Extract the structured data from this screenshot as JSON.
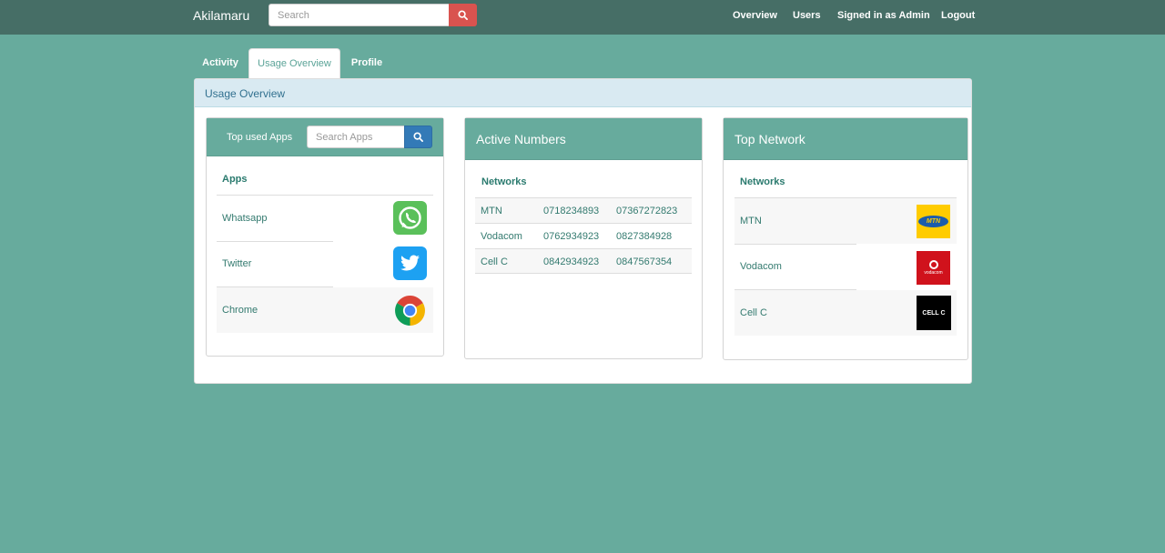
{
  "navbar": {
    "brand": "Akilamaru",
    "search_placeholder": "Search",
    "links": [
      "Overview",
      "Users",
      "Signed in as Admin",
      "Logout"
    ]
  },
  "tabs": [
    "Activity",
    "Usage Overview",
    "Profile"
  ],
  "active_tab": "Usage Overview",
  "panel": {
    "title": "Usage Overview"
  },
  "top_apps": {
    "title": "Top used Apps",
    "search_placeholder": "Search Apps",
    "column": "Apps",
    "rows": [
      {
        "name": "Whatsapp",
        "icon": "whatsapp-icon"
      },
      {
        "name": "Twitter",
        "icon": "twitter-icon"
      },
      {
        "name": "Chrome",
        "icon": "chrome-icon"
      }
    ]
  },
  "active_numbers": {
    "title": "Active Numbers",
    "column": "Networks",
    "rows": [
      {
        "network": "MTN",
        "num1": "0718234893",
        "num2": "07367272823"
      },
      {
        "network": "Vodacom",
        "num1": "0762934923",
        "num2": "0827384928"
      },
      {
        "network": "Cell C",
        "num1": "0842934923",
        "num2": "0847567354"
      }
    ]
  },
  "top_network": {
    "title": "Top Network",
    "column": "Networks",
    "rows": [
      {
        "name": "MTN",
        "logo_text": "MTN",
        "logo": "mtn-logo"
      },
      {
        "name": "Vodacom",
        "logo_text": "vodacom",
        "logo": "vodacom-logo"
      },
      {
        "name": "Cell C",
        "logo_text": "CELL C",
        "logo": "cellc-logo"
      }
    ]
  },
  "colors": {
    "background": "#67ab9d",
    "navbar": "#466e66",
    "search_button": "#d9534f",
    "apps_search_button": "#337ab7",
    "panel_heading": "#d9eaf2"
  }
}
